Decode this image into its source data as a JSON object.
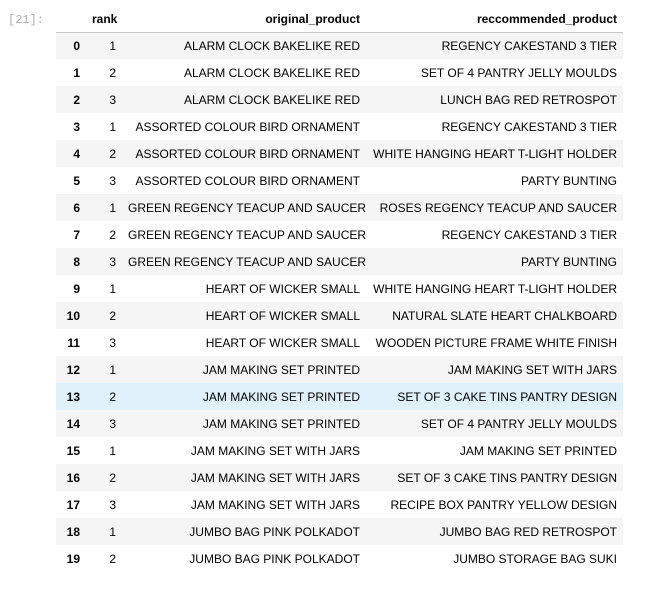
{
  "cell": {
    "prompt": "[21]:"
  },
  "table": {
    "columns": [
      "",
      "rank",
      "original_product",
      "reccommended_product"
    ],
    "highlighted_row": 13,
    "rows": [
      {
        "index": "0",
        "rank": "1",
        "original": "ALARM CLOCK BAKELIKE RED",
        "recommended": "REGENCY CAKESTAND 3 TIER"
      },
      {
        "index": "1",
        "rank": "2",
        "original": "ALARM CLOCK BAKELIKE RED",
        "recommended": "SET OF 4 PANTRY JELLY MOULDS"
      },
      {
        "index": "2",
        "rank": "3",
        "original": "ALARM CLOCK BAKELIKE RED",
        "recommended": "LUNCH BAG RED RETROSPOT"
      },
      {
        "index": "3",
        "rank": "1",
        "original": "ASSORTED COLOUR BIRD ORNAMENT",
        "recommended": "REGENCY CAKESTAND 3 TIER"
      },
      {
        "index": "4",
        "rank": "2",
        "original": "ASSORTED COLOUR BIRD ORNAMENT",
        "recommended": "WHITE HANGING HEART T-LIGHT HOLDER"
      },
      {
        "index": "5",
        "rank": "3",
        "original": "ASSORTED COLOUR BIRD ORNAMENT",
        "recommended": "PARTY BUNTING"
      },
      {
        "index": "6",
        "rank": "1",
        "original": "GREEN REGENCY TEACUP AND SAUCER",
        "recommended": "ROSES REGENCY TEACUP AND SAUCER"
      },
      {
        "index": "7",
        "rank": "2",
        "original": "GREEN REGENCY TEACUP AND SAUCER",
        "recommended": "REGENCY CAKESTAND 3 TIER"
      },
      {
        "index": "8",
        "rank": "3",
        "original": "GREEN REGENCY TEACUP AND SAUCER",
        "recommended": "PARTY BUNTING"
      },
      {
        "index": "9",
        "rank": "1",
        "original": "HEART OF WICKER SMALL",
        "recommended": "WHITE HANGING HEART T-LIGHT HOLDER"
      },
      {
        "index": "10",
        "rank": "2",
        "original": "HEART OF WICKER SMALL",
        "recommended": "NATURAL SLATE HEART CHALKBOARD"
      },
      {
        "index": "11",
        "rank": "3",
        "original": "HEART OF WICKER SMALL",
        "recommended": "WOODEN PICTURE FRAME WHITE FINISH"
      },
      {
        "index": "12",
        "rank": "1",
        "original": "JAM MAKING SET PRINTED",
        "recommended": "JAM MAKING SET WITH JARS"
      },
      {
        "index": "13",
        "rank": "2",
        "original": "JAM MAKING SET PRINTED",
        "recommended": "SET OF 3 CAKE TINS PANTRY DESIGN"
      },
      {
        "index": "14",
        "rank": "3",
        "original": "JAM MAKING SET PRINTED",
        "recommended": "SET OF 4 PANTRY JELLY MOULDS"
      },
      {
        "index": "15",
        "rank": "1",
        "original": "JAM MAKING SET WITH JARS",
        "recommended": "JAM MAKING SET PRINTED"
      },
      {
        "index": "16",
        "rank": "2",
        "original": "JAM MAKING SET WITH JARS",
        "recommended": "SET OF 3 CAKE TINS PANTRY DESIGN"
      },
      {
        "index": "17",
        "rank": "3",
        "original": "JAM MAKING SET WITH JARS",
        "recommended": "RECIPE BOX PANTRY YELLOW DESIGN"
      },
      {
        "index": "18",
        "rank": "1",
        "original": "JUMBO BAG PINK POLKADOT",
        "recommended": "JUMBO BAG RED RETROSPOT"
      },
      {
        "index": "19",
        "rank": "2",
        "original": "JUMBO BAG PINK POLKADOT",
        "recommended": "JUMBO STORAGE BAG SUKI"
      }
    ]
  },
  "colors": {
    "stripe": "#f5f5f5",
    "hover_row": "#e1f1fb",
    "prompt_text": "#b0b0b0",
    "header_rule": "#c9c9c9"
  }
}
